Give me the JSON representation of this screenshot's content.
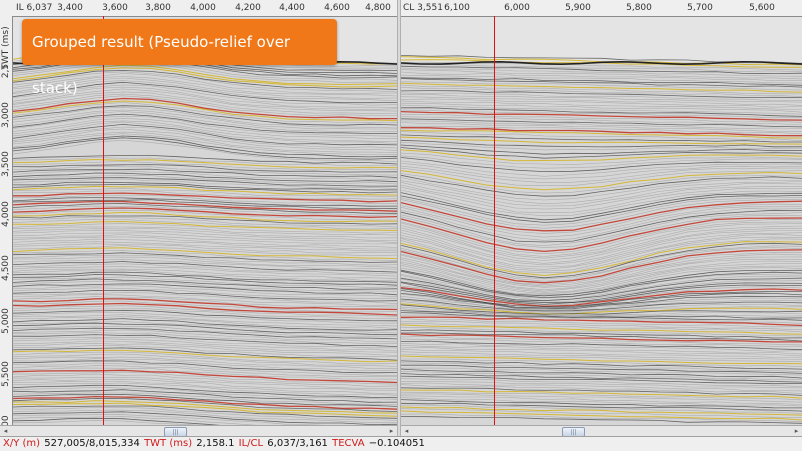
{
  "left_view": {
    "label": "IL 6,037",
    "x_ticks": [
      "3,400",
      "3,600",
      "3,800",
      "4,000",
      "4,200",
      "4,400",
      "4,600",
      "4,800"
    ],
    "y_axis_title": "TWT (ms)",
    "y_ticks": [
      "2,5",
      "3,000",
      "3,500",
      "4,000",
      "4,500",
      "5,000",
      "5,500",
      "000"
    ]
  },
  "right_view": {
    "label": "CL 3,551",
    "x_ticks": [
      "6,100",
      "6,000",
      "5,900",
      "5,800",
      "5,700",
      "5,600"
    ]
  },
  "callout": {
    "text": "Grouped result (Pseudo-relief over stack)",
    "color": "#f07818"
  },
  "status_bar": {
    "xy_label": "X/Y (m)",
    "xy_value": "527,005/8,015,334",
    "twt_label": "TWT (ms)",
    "twt_value": "2,158.1",
    "ilcl_label": "IL/CL",
    "ilcl_value": "6,037/3,161",
    "attr_label": "TECVA",
    "attr_value": "−0.104051",
    "label_color": "#d01a1a"
  },
  "colors": {
    "cursor_line": "#dd1111",
    "positive_amplitude": "#c0392b",
    "mid_amplitude": "#d4b21a",
    "negative_amplitude": "#333333",
    "background": "#c8c8c8"
  },
  "icons": [
    "scroll-left-arrow-icon",
    "scroll-right-arrow-icon",
    "scroll-grip-icon"
  ]
}
